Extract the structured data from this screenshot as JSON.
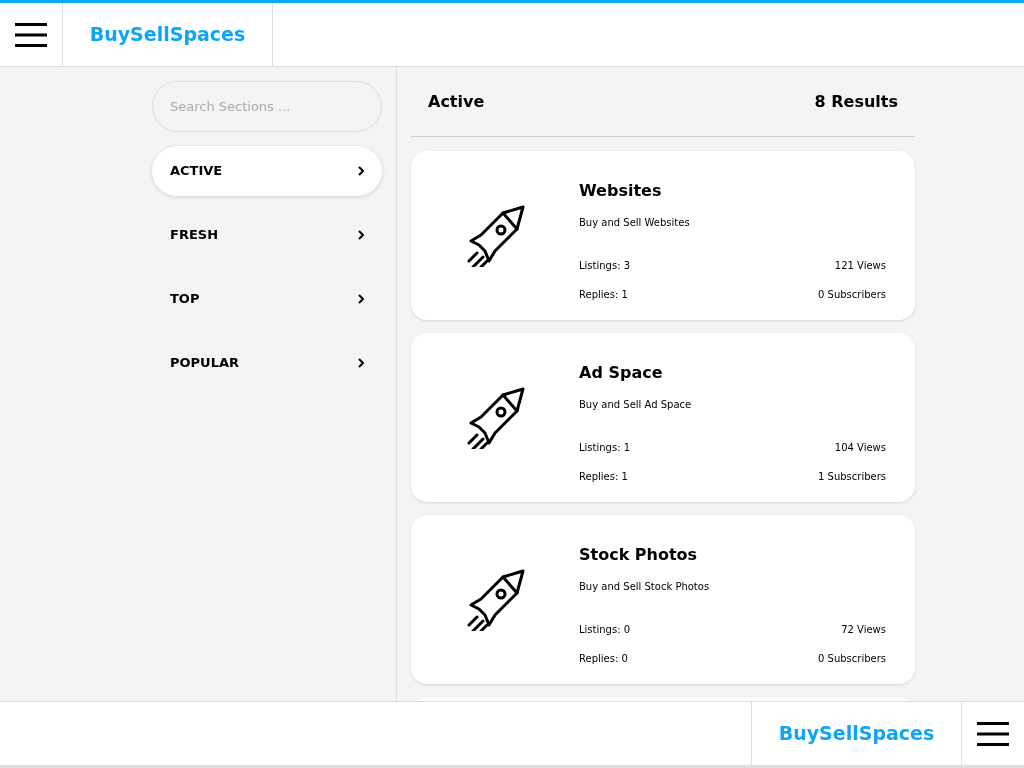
{
  "header": {
    "brand": "BuySellSpaces"
  },
  "sidebar": {
    "search": {
      "placeholder": "Search Sections ..."
    },
    "items": [
      {
        "label": "ACTIVE",
        "selected": true
      },
      {
        "label": "FRESH",
        "selected": false
      },
      {
        "label": "TOP",
        "selected": false
      },
      {
        "label": "POPULAR",
        "selected": false
      }
    ]
  },
  "results": {
    "title": "Active",
    "count": "8 Results",
    "cards": [
      {
        "title": "Websites",
        "subtitle": "Buy and Sell Websites",
        "listings": "Listings: 3",
        "views": "121 Views",
        "replies": "Replies: 1",
        "subscribers": "0 Subscribers"
      },
      {
        "title": "Ad Space",
        "subtitle": "Buy and Sell Ad Space",
        "listings": "Listings: 1",
        "views": "104 Views",
        "replies": "Replies: 1",
        "subscribers": "1 Subscribers"
      },
      {
        "title": "Stock Photos",
        "subtitle": "Buy and Sell Stock Photos",
        "listings": "Listings: 0",
        "views": "72 Views",
        "replies": "Replies: 0",
        "subscribers": "0 Subscribers"
      }
    ]
  },
  "footer": {
    "brand": "BuySellSpaces"
  }
}
